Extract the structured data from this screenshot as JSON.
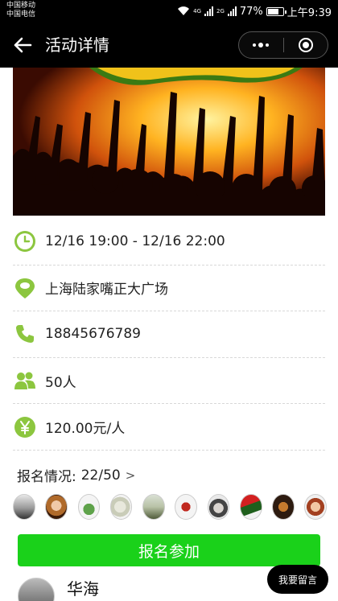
{
  "status_bar": {
    "carrier1": "中国移动",
    "carrier2": "中国电信",
    "net1": "4G",
    "net2": "2G",
    "battery": "77%",
    "battery_level": 0.77,
    "time": "上午9:39"
  },
  "header": {
    "title": "活动详情"
  },
  "banner": {
    "icon": "crowd-concert-image"
  },
  "details": {
    "time": "12/16 19:00 - 12/16 22:00",
    "location": "上海陆家嘴正大广场",
    "phone": "18845676789",
    "people": "50人",
    "price": "120.00元/人"
  },
  "registration": {
    "label": "报名情况:",
    "count": "22/50",
    "arrow": ">"
  },
  "join_button": "报名参加",
  "commenter": {
    "name": "华海"
  },
  "leave_message_button": "我要留言",
  "colors": {
    "accent_green": "#1ad11a",
    "icon_green": "#8cc63f"
  }
}
